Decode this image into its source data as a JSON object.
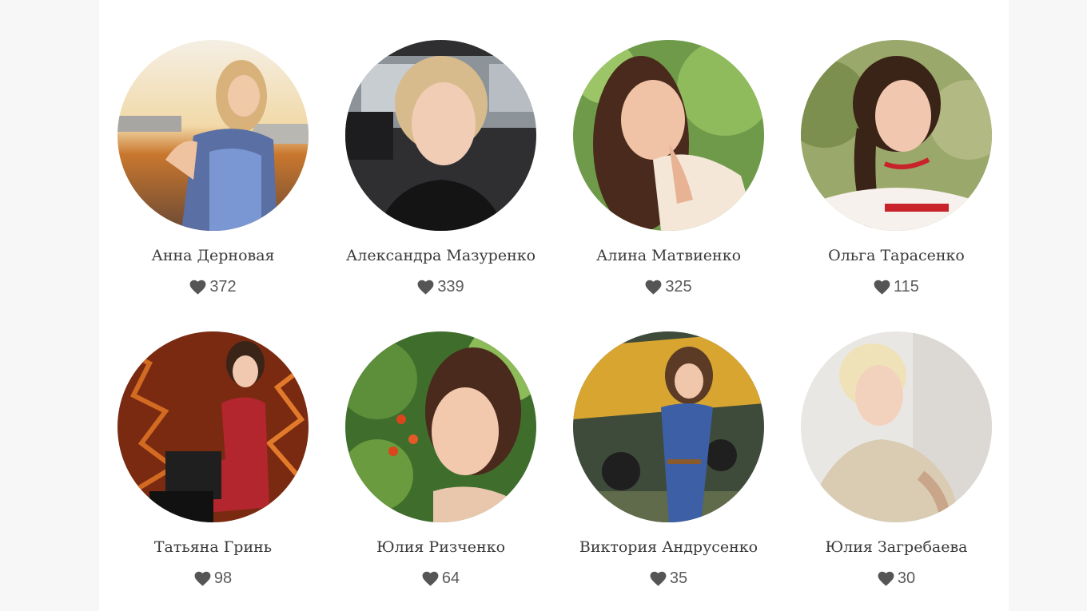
{
  "profiles": [
    {
      "name": "Анна Дерновая",
      "likes": "372"
    },
    {
      "name": "Александра Мазуренко",
      "likes": "339"
    },
    {
      "name": "Алина Матвиенко",
      "likes": "325"
    },
    {
      "name": "Ольга Тарасенко",
      "likes": "115"
    },
    {
      "name": "Татьяна Гринь",
      "likes": "98"
    },
    {
      "name": "Юлия Ризченко",
      "likes": "64"
    },
    {
      "name": "Виктория Андрусенко",
      "likes": "35"
    },
    {
      "name": "Юлия Загребаева",
      "likes": "30"
    }
  ],
  "icons": {
    "like": "heart-icon"
  },
  "colors": {
    "heart": "#555555",
    "name_text": "#3a3a3a",
    "background": "#ffffff"
  }
}
